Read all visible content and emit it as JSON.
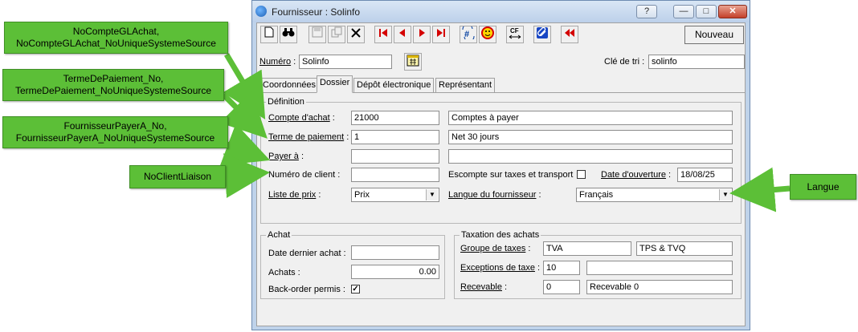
{
  "window": {
    "title": "Fournisseur : Solinfo",
    "help_btn": "?",
    "minimize_btn": "—",
    "maximize_btn": "□",
    "close_btn": "✕"
  },
  "toolbar": {
    "new_label": "Nouveau",
    "icons": [
      "new-doc-icon",
      "find-icon",
      "save-icon",
      "copy-icon",
      "delete-icon",
      "first-icon",
      "prev-icon",
      "next-icon",
      "last-icon",
      "renumber-icon",
      "smiley-icon",
      "cf-icon",
      "attach-icon",
      "back-icon"
    ]
  },
  "header": {
    "numero_label": "Numéro",
    "numero_value": "Solinfo",
    "cle_label": "Clé de tri :",
    "cle_value": "solinfo"
  },
  "tabs": [
    {
      "label": "Coordonnées"
    },
    {
      "label": "Dossier"
    },
    {
      "label": "Dépôt électronique"
    },
    {
      "label": "Représentant"
    }
  ],
  "definition": {
    "title": "Définition",
    "compte_achat_label": "Compte d'achat",
    "compte_achat_value": "21000",
    "compte_achat_desc": "Comptes à payer",
    "terme_label": "Terme de paiement",
    "terme_value": "1",
    "terme_desc": "Net 30 jours",
    "payer_label": "Payer à",
    "payer_value": "",
    "payer_desc": "",
    "client_no_label": "Numéro de client :",
    "client_no_value": "",
    "escompte_label": "Escompte sur taxes et transport",
    "date_ouverture_label": "Date d'ouverture",
    "date_ouverture_value": "18/08/25",
    "liste_prix_label": "Liste de prix",
    "liste_prix_value": "Prix",
    "langue_label": "Langue du fournisseur",
    "langue_value": "Français"
  },
  "achat": {
    "title": "Achat",
    "date_label": "Date dernier achat :",
    "date_value": "",
    "achats_label": "Achats :",
    "achats_value": "0.00",
    "backorder_label": "Back-order permis :",
    "backorder_checked": "✓"
  },
  "taxation": {
    "title": "Taxation des achats",
    "groupe_label": "Groupe de taxes",
    "groupe_code": "TVA",
    "groupe_desc": "TPS & TVQ",
    "exceptions_label": "Exceptions de taxe",
    "exceptions_code": "10",
    "exceptions_desc": "",
    "recevable_label": "Recevable",
    "recevable_code": "0",
    "recevable_desc": "Recevable 0"
  },
  "callouts": {
    "glachat_1": "NoCompteGLAchat,",
    "glachat_2": "NoCompteGLAchat_NoUniqueSystemeSource",
    "terme_1": "TermeDePaiement_No,",
    "terme_2": "TermeDePaiement_NoUniqueSystemeSource",
    "payer_1": "FournisseurPayerA_No,",
    "payer_2": "FournisseurPayerA_NoUniqueSystemeSource",
    "client": "NoClientLiaison",
    "langue": "Langue"
  },
  "colors": {
    "callout_green": "#5cbf37",
    "window_frame": "#bfd3ea",
    "dialog_bg": "#f0f0f0"
  }
}
